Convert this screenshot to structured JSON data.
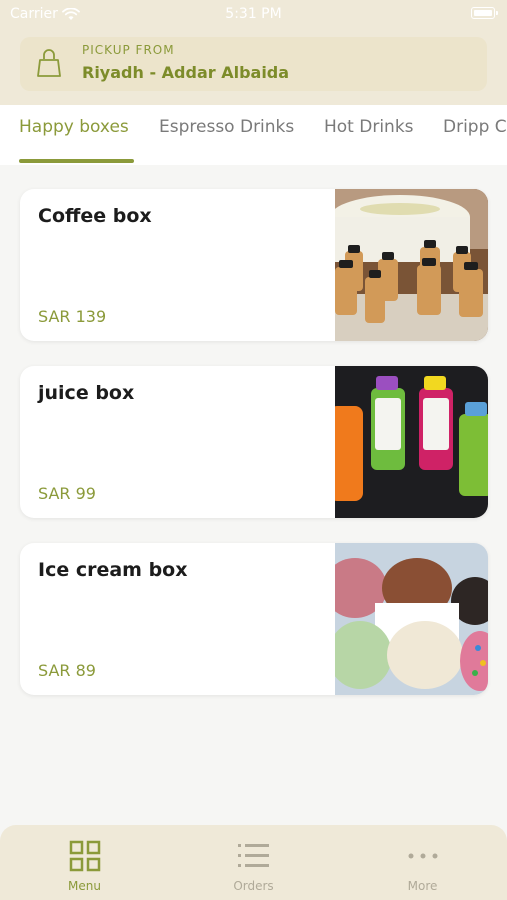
{
  "status_bar": {
    "carrier": "Carrier",
    "time": "5:31 PM"
  },
  "pickup": {
    "label": "PICKUP FROM",
    "location": "Riyadh - Addar Albaida"
  },
  "tabs": [
    {
      "label": "Happy boxes",
      "active": true
    },
    {
      "label": "Espresso Drinks",
      "active": false
    },
    {
      "label": "Hot Drinks",
      "active": false
    },
    {
      "label": "Dripp C",
      "active": false
    }
  ],
  "products": [
    {
      "name": "Coffee box",
      "price": "SAR 139",
      "image": "coffee-bottles-image"
    },
    {
      "name": "juice box",
      "price": "SAR 99",
      "image": "juice-bottles-image"
    },
    {
      "name": "Ice cream box",
      "price": "SAR 89",
      "image": "ice-cream-cups-image"
    }
  ],
  "bottom_nav": [
    {
      "label": "Menu",
      "icon": "grid-icon",
      "active": true
    },
    {
      "label": "Orders",
      "icon": "list-icon",
      "active": false
    },
    {
      "label": "More",
      "icon": "more-dots-icon",
      "active": false
    }
  ],
  "colors": {
    "accent": "#8b9a3a",
    "header_bg": "#efe9d8",
    "page_bg": "#f6f6f4"
  }
}
